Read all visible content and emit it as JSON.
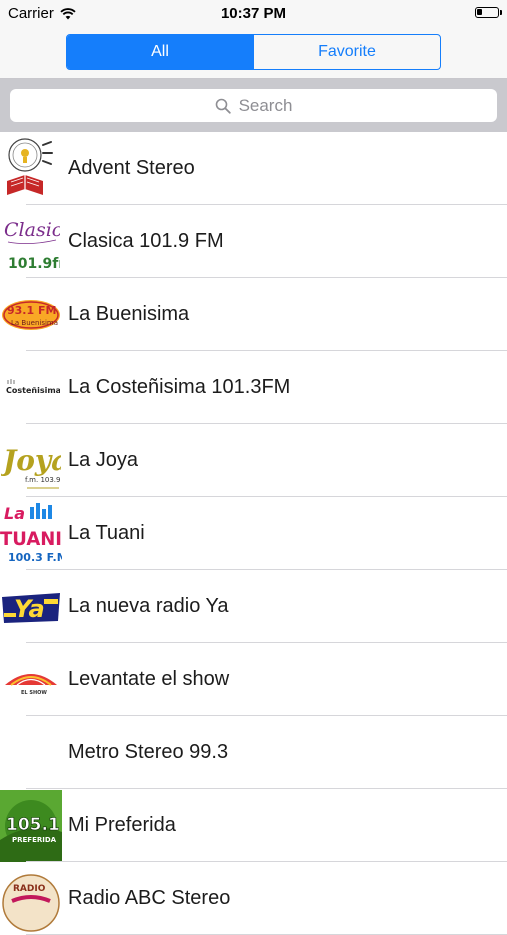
{
  "status": {
    "carrier": "Carrier",
    "time": "10:37 PM",
    "battery_level": 0.25
  },
  "tabs": [
    {
      "label": "All",
      "selected": true
    },
    {
      "label": "Favorite",
      "selected": false
    }
  ],
  "search": {
    "placeholder": "Search"
  },
  "stations": [
    {
      "name": "Advent Stereo"
    },
    {
      "name": "Clasica 101.9 FM"
    },
    {
      "name": "La Buenisima"
    },
    {
      "name": "La Costeñisima 101.3FM"
    },
    {
      "name": "La Joya"
    },
    {
      "name": "La Tuani"
    },
    {
      "name": "La nueva radio Ya"
    },
    {
      "name": "Levantate el show"
    },
    {
      "name": "Metro Stereo 99.3"
    },
    {
      "name": "Mi Preferida"
    },
    {
      "name": "Radio ABC Stereo"
    }
  ],
  "logos": {
    "clasica": {
      "line1": "Clasica",
      "line2": "101.9fm"
    },
    "buenisima": {
      "line1": "93.1 FM",
      "line2": "La Buenisima"
    },
    "costenisima": {
      "line1": "Costeñisima"
    },
    "joya": {
      "line1": "Joya",
      "line2": "f.m. 103.9"
    },
    "tuani": {
      "line1": "La",
      "line2": "TUANI",
      "line3": "100.3 F.M."
    },
    "ya": {
      "line1": "Ya"
    },
    "levantate": {
      "line1": "EL SHOW"
    },
    "preferida": {
      "line1": "105.1",
      "line2": "PREFERIDA"
    },
    "abc": {
      "line1": "RADIO"
    }
  },
  "colors": {
    "accent": "#157efb"
  }
}
